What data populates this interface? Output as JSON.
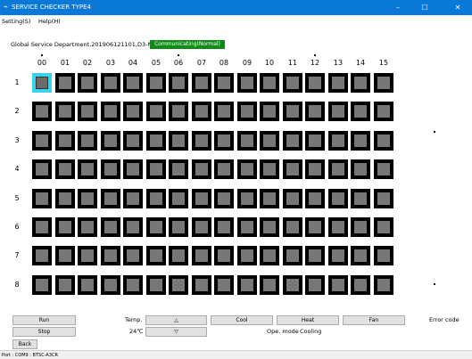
{
  "window": {
    "title": "SERVICE CHECKER TYPE4",
    "app_icon": "app-icon",
    "minimize": "–",
    "maximize": "☐",
    "close": "✕"
  },
  "menu": {
    "items": [
      "Setting(S)",
      "Help(H)"
    ]
  },
  "status": {
    "info": "Global Service Department,201906121101,D3-NET",
    "communication": "Communicating(Normal)"
  },
  "grid": {
    "columns": [
      "00",
      "01",
      "02",
      "03",
      "04",
      "05",
      "06",
      "07",
      "08",
      "09",
      "10",
      "11",
      "12",
      "13",
      "14",
      "15"
    ],
    "rows": [
      "1",
      "2",
      "3",
      "4",
      "5",
      "6",
      "7",
      "8"
    ],
    "selected": "row 1 col 00",
    "colors": {
      "cell": "#000000",
      "inner": "#777777",
      "selected": "#3cd2ea"
    }
  },
  "controls": {
    "run": "Run",
    "stop": "Stop",
    "back": "Back",
    "temp_label": "Temp.",
    "temp_value": "24℃",
    "up": "△",
    "down": "▽",
    "cool": "Cool",
    "heat": "Heat",
    "fan": "Fan",
    "ope_mode_label": "Ope. mode",
    "ope_mode_value": "Cooling",
    "error_code_label": "Error code"
  },
  "statusbar": {
    "port": "Port : COM9 : BTSC-A3CR"
  },
  "accent": {
    "titlebar": "#0a78d7",
    "badge": "#128a1a"
  }
}
